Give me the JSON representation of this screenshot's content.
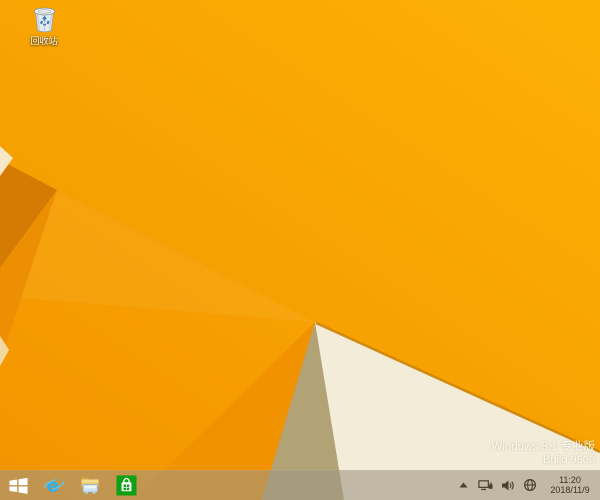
{
  "wallpaper": {
    "colors": {
      "bg_top": "#fcb004",
      "bg_bottom": "#f39500",
      "highlight_band": "rgba(255,255,255,0.05)",
      "dark_triangle": "#d57b03",
      "medium_wedge": "#ed8f03",
      "shadow_facet": "#f19200",
      "pale_sliver_top": "#f6e8c6",
      "pale_sliver_mid": "#f1e0b2",
      "tan_wedge": "#b2a376",
      "cream_triangle": "#f2ecd9",
      "ridge_line": "#cd8404"
    }
  },
  "desktop": {
    "icons": [
      {
        "label": "回收站",
        "icon": "recycle-bin-icon"
      }
    ],
    "watermark": {
      "line1": "Windows 8.1 专业版",
      "line2": "Build 9600"
    }
  },
  "taskbar": {
    "buttons": [
      {
        "id": "start",
        "icon": "windows-start-icon"
      },
      {
        "id": "internet-explorer",
        "icon": "internet-explorer-icon"
      },
      {
        "id": "file-explorer",
        "icon": "file-explorer-icon"
      },
      {
        "id": "windows-store",
        "icon": "windows-store-icon"
      }
    ],
    "tray": {
      "icons": [
        "show-hidden-icons-icon",
        "network-icon",
        "volume-icon",
        "input-indicator-icon"
      ],
      "clock": {
        "time": "11:20",
        "date": "2018/11/9"
      }
    }
  }
}
